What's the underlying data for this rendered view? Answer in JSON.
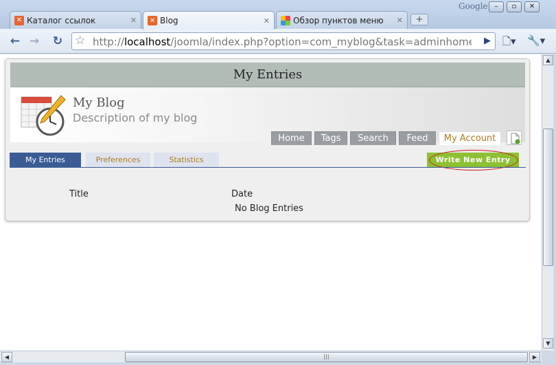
{
  "browser": {
    "tabs": [
      {
        "label": "Каталог ссылок",
        "favicon": "joomla-orange-icon",
        "active": false
      },
      {
        "label": "Blog",
        "favicon": "joomla-orange-icon",
        "active": true
      },
      {
        "label": "Обзор пунктов меню",
        "favicon": "joomla-logo-icon",
        "active": false
      }
    ],
    "new_tab_glyph": "+",
    "brand": "Google",
    "window_buttons": [
      "–",
      "▫",
      "✕"
    ],
    "url_prefix": "http://",
    "url_host": "localhost",
    "url_path": "/joomla/index.php?option=com_myblog&task=adminhome&Itemid",
    "accent_color": "#3b5d8a"
  },
  "page": {
    "header_title": "My Entries",
    "blog_title": "My Blog",
    "blog_description": "Description of my blog",
    "menu": [
      {
        "label": "Home",
        "active": false
      },
      {
        "label": "Tags",
        "active": false
      },
      {
        "label": "Search",
        "active": false
      },
      {
        "label": "Feed",
        "active": false
      },
      {
        "label": "My Account",
        "active": true
      }
    ],
    "subtabs": [
      {
        "label": "My Entries",
        "active": true
      },
      {
        "label": "Preferences",
        "active": false
      },
      {
        "label": "Statistics",
        "active": false
      }
    ],
    "write_button": "Write New Entry",
    "table": {
      "columns": [
        "Title",
        "Date"
      ],
      "empty_message": "No Blog Entries"
    },
    "colors": {
      "header_bg": "#b3bdb8",
      "tab_active_bg": "#3a5b94",
      "tab_text": "#b07b1c",
      "write_button_bg": "#8ec033",
      "highlight_ellipse": "#cc1a1a"
    }
  }
}
